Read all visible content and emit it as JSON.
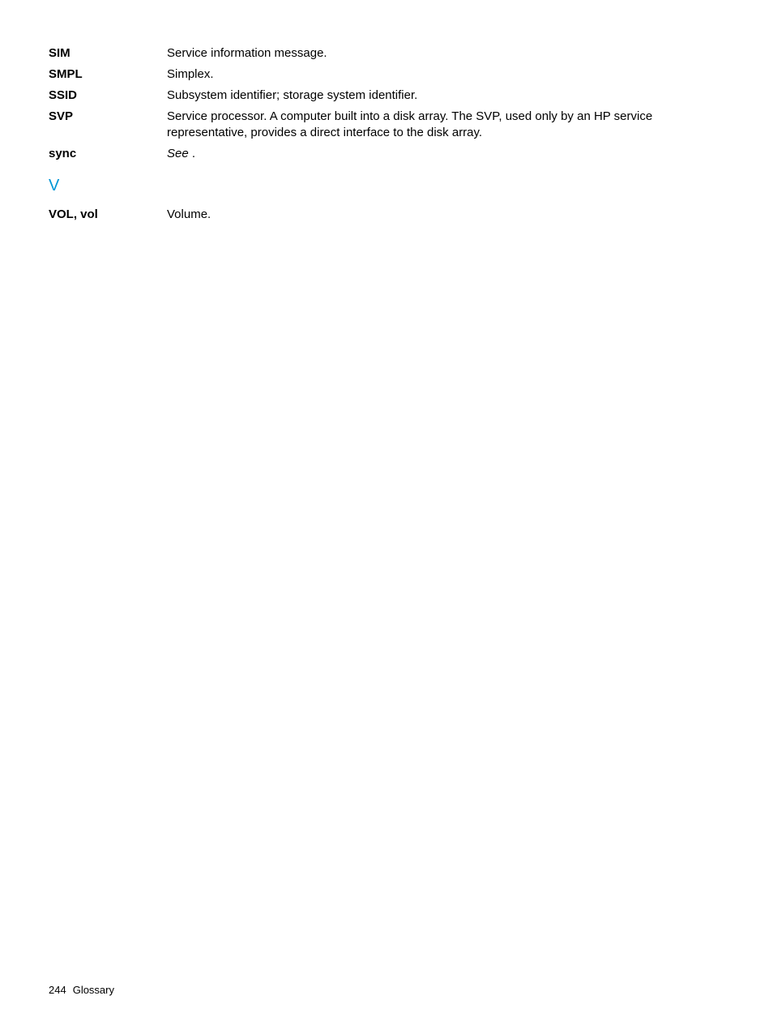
{
  "glossary": {
    "entries_s": [
      {
        "term": "SIM",
        "def": "Service information message."
      },
      {
        "term": "SMPL",
        "def": "Simplex."
      },
      {
        "term": "SSID",
        "def": "Subsystem identifier; storage system identifier."
      },
      {
        "term": "SVP",
        "def": "Service processor. A computer built into a disk array. The SVP, used only by an HP service representative, provides a direct interface to the disk array."
      },
      {
        "term": "sync",
        "def_prefix": "See",
        "def_suffix": " ."
      }
    ],
    "section_v_letter": "V",
    "entries_v": [
      {
        "term": "VOL, vol",
        "def": "Volume."
      }
    ]
  },
  "footer": {
    "page_number": "244",
    "section": "Glossary"
  }
}
